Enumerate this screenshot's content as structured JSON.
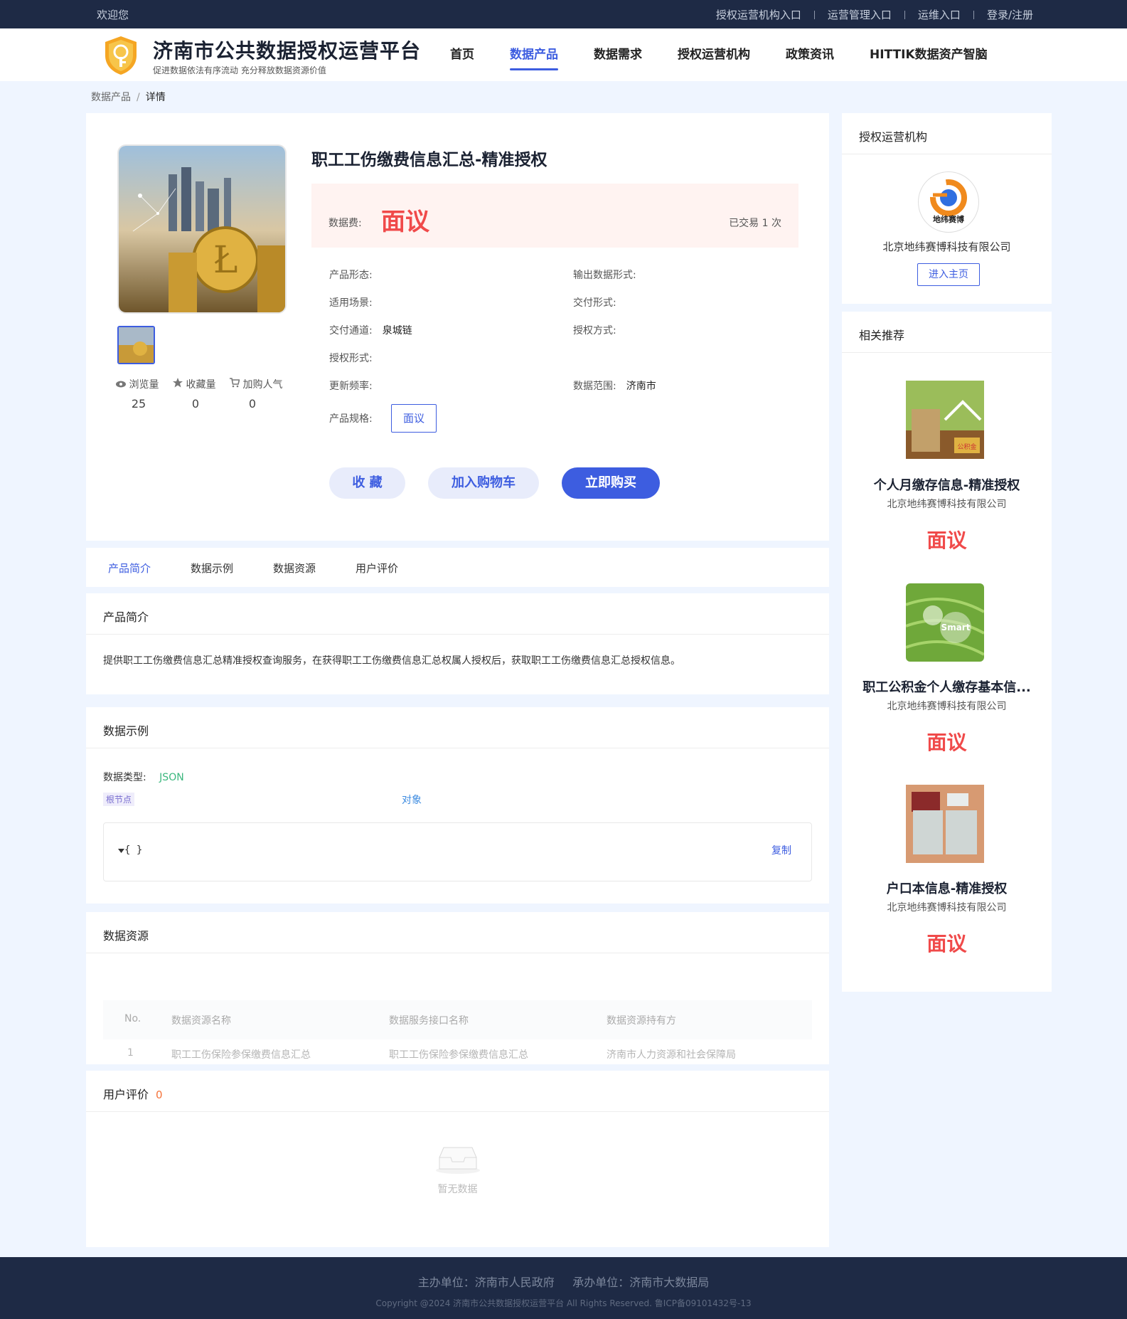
{
  "topbar": {
    "welcome": "欢迎您",
    "links": [
      "授权运营机构入口",
      "运营管理入口",
      "运维入口",
      "登录/注册"
    ]
  },
  "header": {
    "title": "济南市公共数据授权运营平台",
    "subtitle": "促进数据依法有序流动 充分释放数据资源价值",
    "nav": [
      "首页",
      "数据产品",
      "数据需求",
      "授权运营机构",
      "政策资讯",
      "HITTIK数据资产智脑"
    ],
    "active_nav": "数据产品"
  },
  "breadcrumb": {
    "parent": "数据产品",
    "separator": "/",
    "current": "详情"
  },
  "product": {
    "title": "职工工伤缴费信息汇总-精准授权",
    "price_label": "数据费:",
    "price": "面议",
    "traded": "已交易 1 次",
    "stats": [
      {
        "label": "浏览量",
        "value": "25",
        "icon": "eye-icon"
      },
      {
        "label": "收藏量",
        "value": "0",
        "icon": "star-icon"
      },
      {
        "label": "加购人气",
        "value": "0",
        "icon": "cart-icon"
      }
    ],
    "attrs": {
      "form_label": "产品形态:",
      "form_value": "",
      "output_label": "输出数据形式:",
      "output_value": "",
      "scene_label": "适用场景:",
      "scene_value": "",
      "delivery_form_label": "交付形式:",
      "delivery_form_value": "",
      "channel_label": "交付通道:",
      "channel_value": "泉城链",
      "auth_method_label": "授权方式:",
      "auth_method_value": "",
      "auth_form_label": "授权形式:",
      "auth_form_value": "",
      "freq_label": "更新频率:",
      "freq_value": "",
      "range_label": "数据范围:",
      "range_value": "济南市",
      "spec_label": "产品规格:",
      "spec_value": "面议"
    },
    "actions": {
      "favorite": "收 藏",
      "cart": "加入购物车",
      "buy": "立即购买"
    }
  },
  "tabs": [
    "产品简介",
    "数据示例",
    "数据资源",
    "用户评价"
  ],
  "intro": {
    "heading": "产品简介",
    "text": "提供职工工伤缴费信息汇总精准授权查询服务，在获得职工工伤缴费信息汇总权属人授权后，获取职工工伤缴费信息汇总授权信息。"
  },
  "example": {
    "heading": "数据示例",
    "type_label": "数据类型:",
    "type_value": "JSON",
    "root_tag": "根节点",
    "root_type": "对象",
    "json_text": "{ }",
    "copy": "复制"
  },
  "resources": {
    "heading": "数据资源",
    "columns": [
      "No.",
      "数据资源名称",
      "数据服务接口名称",
      "数据资源持有方"
    ],
    "rows": [
      [
        "1",
        "职工工伤保险参保缴费信息汇总",
        "职工工伤保险参保缴费信息汇总",
        "济南市人力资源和社会保障局"
      ]
    ]
  },
  "reviews": {
    "heading": "用户评价",
    "count": "0",
    "empty": "暂无数据"
  },
  "sidebar": {
    "org_heading": "授权运营机构",
    "org_logo_text": "地纬赛博",
    "org_name": "北京地纬赛博科技有限公司",
    "org_button": "进入主页",
    "rec_heading": "相关推荐",
    "recommendations": [
      {
        "title": "个人月缴存信息-精准授权",
        "org": "北京地纬赛博科技有限公司",
        "price": "面议",
        "img_tag": "公积金"
      },
      {
        "title": "职工公积金个人缴存基本信...",
        "org": "北京地纬赛博科技有限公司",
        "price": "面议",
        "img_tag": "Smart"
      },
      {
        "title": "户口本信息-精准授权",
        "org": "北京地纬赛博科技有限公司",
        "price": "面议",
        "img_tag": ""
      }
    ]
  },
  "footer": {
    "line1": "主办单位：济南市人民政府     承办单位：济南市大数据局",
    "line2": "Copyright @2024 济南市公共数据授权运营平台 All Rights Reserved. 鲁ICP备09101432号-13"
  },
  "colors": {
    "primary": "#3d5de0",
    "price": "#f04a4a",
    "dark_bar": "#1e2a45",
    "page_bg": "#eff5ff"
  }
}
